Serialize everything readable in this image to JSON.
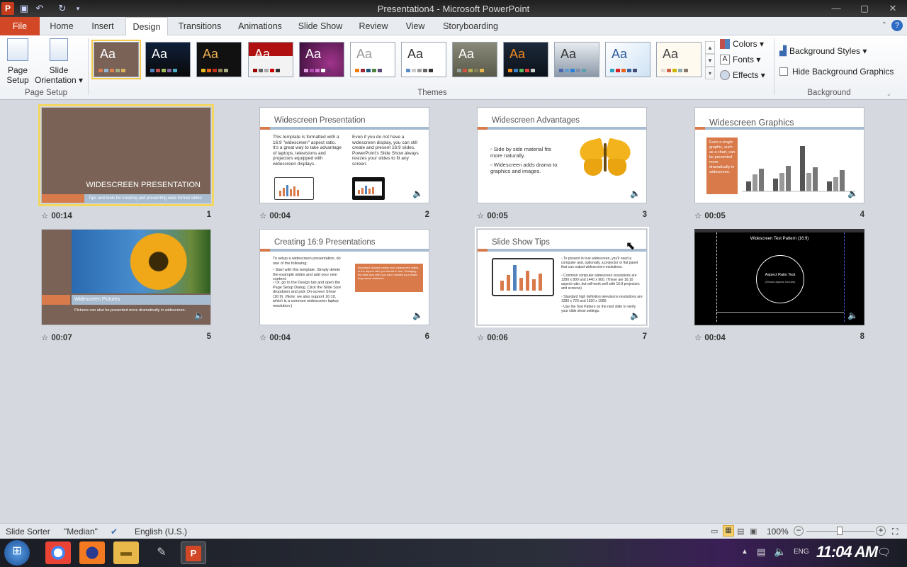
{
  "window": {
    "title": "Presentation4 - Microsoft PowerPoint"
  },
  "tabs": [
    {
      "label": "File"
    },
    {
      "label": "Home"
    },
    {
      "label": "Insert"
    },
    {
      "label": "Design"
    },
    {
      "label": "Transitions"
    },
    {
      "label": "Animations"
    },
    {
      "label": "Slide Show"
    },
    {
      "label": "Review"
    },
    {
      "label": "View"
    },
    {
      "label": "Storyboarding"
    }
  ],
  "ribbon": {
    "page_setup_label": "Page\nSetup",
    "page_setup_line1": "Page",
    "page_setup_line2": "Setup",
    "orientation_line1": "Slide",
    "orientation_line2": "Orientation ▾",
    "group_page_setup": "Page Setup",
    "group_themes": "Themes",
    "group_background": "Background",
    "colors": "Colors ▾",
    "fonts": "Fonts ▾",
    "effects": "Effects ▾",
    "background_styles": "Background Styles ▾",
    "hide_background": "Hide Background Graphics",
    "theme_aa": "Aa"
  },
  "slides": [
    {
      "num": "1",
      "time": "00:14",
      "title": "WIDESCREEN PRESENTATION",
      "subtitle": "Tips and tools for creating and presenting wide format slides"
    },
    {
      "num": "2",
      "time": "00:04",
      "title": "Widescreen Presentation",
      "col1": "This template is formatted with a 16:9 \"widescreen\" aspect ratio. It's a great way to take advantage of laptops, televisions and projectors equipped with widescreen displays.",
      "col2": "Even if you do not have a widescreen display, you can still create and present 16:9 slides. PowerPoint's Slide Show always resizes your slides to fit any screen."
    },
    {
      "num": "3",
      "time": "00:05",
      "title": "Widescreen Advantages",
      "b1": "Side by side material fits more naturally.",
      "b2": "Widescreen adds drama to graphics and images."
    },
    {
      "num": "4",
      "time": "00:05",
      "title": "Widescreen Graphics",
      "box": "Even a single graphic, such as a chart, can be presented more dramatically in widescreen."
    },
    {
      "num": "5",
      "time": "00:07",
      "title": "Widescreen Pictures",
      "subtitle": "Pictures can also be presented more dramatically in widescreen."
    },
    {
      "num": "6",
      "time": "00:04",
      "title": "Creating 16:9 Presentations",
      "body": "To setup a widescreen presentation, do one of the following:",
      "b1": "Start with this template. Simply delete the example slides and add your own content.",
      "b2": "Or, go to the Design tab and open the Page Setup Dialog. Click the Slide Size dropdown and pick On-screen Show (16:9). (Note: we also support 16:10, which is a common widescreen laptop resolution.)",
      "box": "Important: Always create your widescreen slides in the aspect ratio you intend to use. Changing the slide size after you have created your slides may cause distortion."
    },
    {
      "num": "7",
      "time": "00:06",
      "title": "Slide Show Tips",
      "b1": "To present in true widescreen, you'll need a computer and, optionally, a projector or flat panel that can output widescreen resolutions.",
      "b2": "Common computer widescreen resolutions are 1280 x 800 and 1440 x 900. (These are 16:10 aspect ratio, but will work well with 16:9 projectors and screens)",
      "b3": "Standard high definition televisions resolutions are 1280 x 720 and 1920 x 1080.",
      "b4": "Use the Test Pattern on the next slide to verify your slide show settings."
    },
    {
      "num": "8",
      "time": "00:04",
      "title": "Widescreen Test Pattern (16:9)",
      "circle": "Aspect Ratio Test",
      "circle_sub": "(Should appear circular)"
    }
  ],
  "status": {
    "view": "Slide Sorter",
    "theme": "\"Median\"",
    "language": "English (U.S.)",
    "zoom": "100%"
  },
  "taskbar": {
    "time": "11:04 AM",
    "lang": "ENG"
  }
}
